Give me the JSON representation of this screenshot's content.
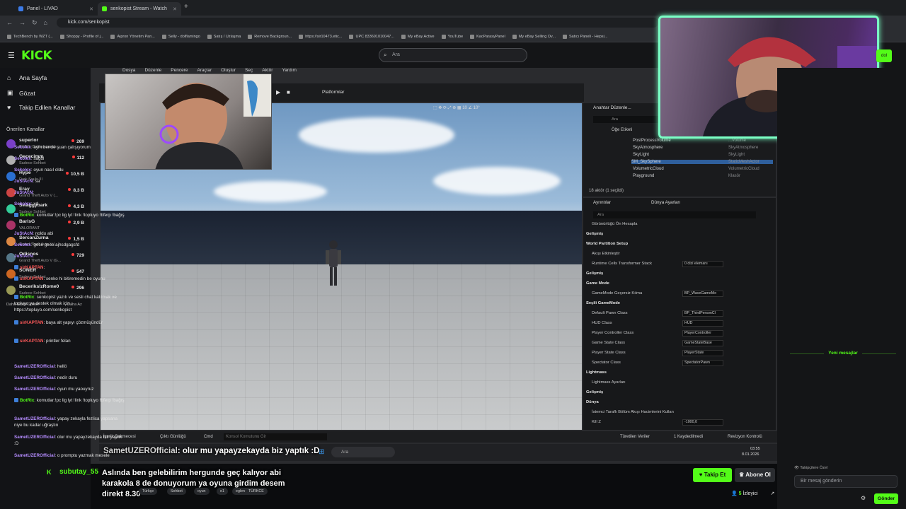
{
  "browser": {
    "tabs": [
      {
        "title": "Panel - LIVAD",
        "color": "#3c7be8"
      },
      {
        "title": "senkopist Stream - Watch",
        "color": "#53fc18"
      }
    ],
    "url": "kick.com/senkopist",
    "bookmarks": [
      "TechBench by WZT (...",
      "Shoppy - Profile of j...",
      "Aipron Yönetim Pan...",
      "Selly - dolflamingo",
      "Satış / Uzlaşma",
      "Remove Backgroun...",
      "https://sir10473.etic...",
      "UPC 833691010047...",
      "My eBay Active",
      "YouTube",
      "KacParasyPanel",
      "My eBay Selling Ov...",
      "Satıcı Paneli - Hepsi..."
    ]
  },
  "kick": {
    "logo": "KICK",
    "search_placeholder": "Ara",
    "nav": [
      {
        "label": "Ana Sayfa",
        "icon": "home-icon",
        "glyph": "⌂"
      },
      {
        "label": "Gözat",
        "icon": "browse-icon",
        "glyph": "▣"
      },
      {
        "label": "Takip Edilen Kanallar",
        "icon": "heart-icon",
        "glyph": "♥"
      }
    ],
    "recommended_title": "Önerilen Kanallar",
    "channels": [
      {
        "name": "superlor",
        "game": "PUBG: Battlegrounds",
        "viewers": "269",
        "color": "#7a3fc9"
      },
      {
        "name": "Gececimm",
        "game": "Sadece Sohbet",
        "viewers": "112",
        "color": "#b0b0b0"
      },
      {
        "name": "Hype",
        "game": "Dark Souls III",
        "viewers": "10,5 B",
        "color": "#2a6fd1"
      },
      {
        "name": "Eray",
        "game": "Grand Theft Auto V (...",
        "viewers": "8,3 B",
        "color": "#c44"
      },
      {
        "name": "Swaggybark",
        "game": "Sadece Sohbet",
        "viewers": "4,3 B",
        "color": "#3c9"
      },
      {
        "name": "BarisG",
        "game": "VALORANT",
        "viewers": "2,9 B",
        "color": "#a36"
      },
      {
        "name": "SercanZurna",
        "game": "Grand Theft Auto V (...",
        "viewers": "1,5 B",
        "color": "#d84"
      },
      {
        "name": "Odisnos",
        "game": "Grand Theft Auto V (G...",
        "viewers": "729",
        "color": "#578"
      },
      {
        "name": "SONER",
        "game": "Sadece Sohbet",
        "viewers": "547",
        "color": "#c62"
      },
      {
        "name": "BecerikslzRome0",
        "game": "Sadece Sohbet",
        "viewers": "296",
        "color": "#995"
      }
    ],
    "show_more": "Daha Fazla Göster",
    "show_less": "Daha Az"
  },
  "ue": {
    "menu": [
      "Dosya",
      "Düzenle",
      "Pencere",
      "Araçlar",
      "Oluştur",
      "Seç",
      "Aktör",
      "Yardım"
    ],
    "platforms": "Platformlar",
    "outliner_title": "Anahtar Düzenle...",
    "outliner_search": "Ara",
    "outliner_col": "Öğe Etiketi",
    "outliner_rows": [
      {
        "name": "PostProcessVolume",
        "type": "...Volume"
      },
      {
        "name": "SkyAtmosphere",
        "type": "SkyAtmosphere"
      },
      {
        "name": "SkyLight",
        "type": "SkyLight"
      },
      {
        "name": "SM_SkySphere",
        "type": "StaticMeshActor"
      },
      {
        "name": "VolumetricCloud",
        "type": "VolumetricCloud"
      },
      {
        "name": "Playground",
        "type": "Klasör"
      }
    ],
    "outliner_count": "18 aktör (1 seçildi)",
    "details_tab": "Ayrıntılar",
    "world_tab": "Dünya Ayarları",
    "details_search": "Ara",
    "details_rows": [
      {
        "kind": "row",
        "label": "Görünürlüğü Ön Hesapla"
      },
      {
        "kind": "hdr",
        "label": "Gelişmiş"
      },
      {
        "kind": "hdr",
        "label": "World Partition Setup"
      },
      {
        "kind": "row",
        "label": "Akışı Etkinleştir"
      },
      {
        "kind": "row",
        "label": "Runtime Cells Transformer Stack",
        "value": "0 dizi elemanı"
      },
      {
        "kind": "hdr",
        "label": "Gelişmiş"
      },
      {
        "kind": "hdr",
        "label": "Game Mode"
      },
      {
        "kind": "row",
        "label": "GameMode Geçersiz Kılma",
        "value": "BP_WaveGameMo"
      },
      {
        "kind": "hdr",
        "label": "Seçili GameMode"
      },
      {
        "kind": "row",
        "label": "Default Pawn Class",
        "value": "BP_ThirdPersonCl"
      },
      {
        "kind": "row",
        "label": "HUD Class",
        "value": "HUD"
      },
      {
        "kind": "row",
        "label": "Player Controller Class",
        "value": "PlayerController"
      },
      {
        "kind": "row",
        "label": "Game State Class",
        "value": "GameStateBase"
      },
      {
        "kind": "row",
        "label": "Player State Class",
        "value": "PlayerState"
      },
      {
        "kind": "row",
        "label": "Spectator Class",
        "value": "SpectatorPawn"
      },
      {
        "kind": "hdr",
        "label": "Lightmass"
      },
      {
        "kind": "row",
        "label": "Lightmass Ayarları"
      },
      {
        "kind": "hdr",
        "label": "Gelişmiş"
      },
      {
        "kind": "hdr",
        "label": "Dünya"
      },
      {
        "kind": "row",
        "label": "İstemci Taraflı Bölüm Akışı Hacimlerini Kullan"
      },
      {
        "kind": "row",
        "label": "Kill Z",
        "value": "-1000,0"
      }
    ],
    "bottom": [
      "İçerik Çekmecesi",
      "Çıktı Günlüğü",
      "Cmd",
      "Türetilen Veriler",
      "1 Kaydedilmedi",
      "Revizyon Kontrolü"
    ],
    "cmd_placeholder": "Konsol Komutunu Gir",
    "task_search": "Ara",
    "clock_time": "03:55",
    "clock_date": "8.01.2026"
  },
  "captions": {
    "line1_user": "SametUZEROfficial",
    "line1_text": ": olur mu yapayzekayda biz yaptık :D",
    "line2": "Aslında ben gelebilirim hergunde geç kalıyor abi karakola 8 de donuyorum ya oyuna girdim desem direkt 8.30"
  },
  "stream": {
    "streamer": "subutay_55",
    "tags": [
      "Türkçe",
      "Sohbet",
      "oyun",
      "e1",
      "eglence",
      "TÜRKCE"
    ],
    "follow": "Takip Et",
    "subscribe": "Abone Ol",
    "viewers_count": "5",
    "viewers_label": "İzleyici"
  },
  "chat": {
    "messages": [
      {
        "user": "Sekolex",
        "text": "aynı bende şuan çalışıyorum",
        "color": "#b58cff",
        "bot": false
      },
      {
        "user": "Sekolex",
        "text": "sağol",
        "color": "#b58cff",
        "bot": false
      },
      {
        "user": "Sekolex",
        "text": "oyun nasıl oldu",
        "color": "#b58cff",
        "bot": false
      },
      {
        "user": "JuStAcN",
        "text": "sa",
        "color": "#b58cff",
        "bot": false
      },
      {
        "user": "JuStAcN",
        "text": "",
        "color": "#b58cff",
        "bot": false
      },
      {
        "user": "Sekolex",
        "text": "xd",
        "color": "#b58cff",
        "bot": false
      },
      {
        "user": "BotRix",
        "text": "komutlar:!pc lig lyt !link !topluyo !bferp !bağış",
        "color": "#53fc18",
        "bot": true
      },
      {
        "user": "JuStAcN",
        "text": "noldu abi",
        "color": "#b58cff",
        "bot": false
      },
      {
        "user": "Sekolex",
        "text": "gece gece ajhsdgagsfd",
        "color": "#b58cff",
        "bot": false
      },
      {
        "user": "JuStAcN",
        "text": "",
        "color": "#b58cff",
        "bot": false
      },
      {
        "user": "sirKAPTAN",
        "text": "",
        "color": "#ff5a5a",
        "bot": true
      },
      {
        "user": "sirKAPTAN",
        "text": "senko hi bitiremedin be oyunu",
        "color": "#ff5a5a",
        "bot": true
      },
      {
        "user": "BotRix",
        "text": "senkopist yazılı ve sesli chat katılmak ve topluyo ya destek olmak için : https://topluyo.com/senkopist",
        "color": "#53fc18",
        "bot": true
      },
      {
        "user": "sirKAPTAN",
        "text": "baya alt yapıyı çözmüşündür",
        "color": "#ff5a5a",
        "bot": true
      },
      {
        "user": "sirKAPTAN",
        "text": "printler felan",
        "color": "#ff5a5a",
        "bot": true
      }
    ],
    "new_messages_label": "Yeni mesajlar",
    "new_messages": [
      {
        "user": "SametUZEROfficial",
        "text": "hellö",
        "color": "#b58cff",
        "bot": false
      },
      {
        "user": "SametUZEROfficial",
        "text": "nedir duru",
        "color": "#b58cff",
        "bot": false
      },
      {
        "user": "SametUZEROfficial",
        "text": "oyun mu yaouyruz",
        "color": "#b58cff",
        "bot": false
      },
      {
        "user": "BotRix",
        "text": "komutlar:!pc lig lyt !link !topluyo !bferp !bağış",
        "color": "#53fc18",
        "bot": true
      },
      {
        "user": "SametUZEROfficial",
        "text": "yapay zekayla fezlica yapsana niye bu kadar uğraştın",
        "color": "#b58cff",
        "bot": false
      },
      {
        "user": "SametUZEROfficial",
        "text": "olur mu yapayzekayda biz yaptık :D",
        "color": "#b58cff",
        "bot": false
      },
      {
        "user": "SametUZEROfficial",
        "text": "o promptu yazmak mesele",
        "color": "#b58cff",
        "bot": false
      }
    ],
    "followers_only": "Takipçilere Özel",
    "input_placeholder": "Bir mesaj gönderin",
    "send": "Gönder"
  }
}
